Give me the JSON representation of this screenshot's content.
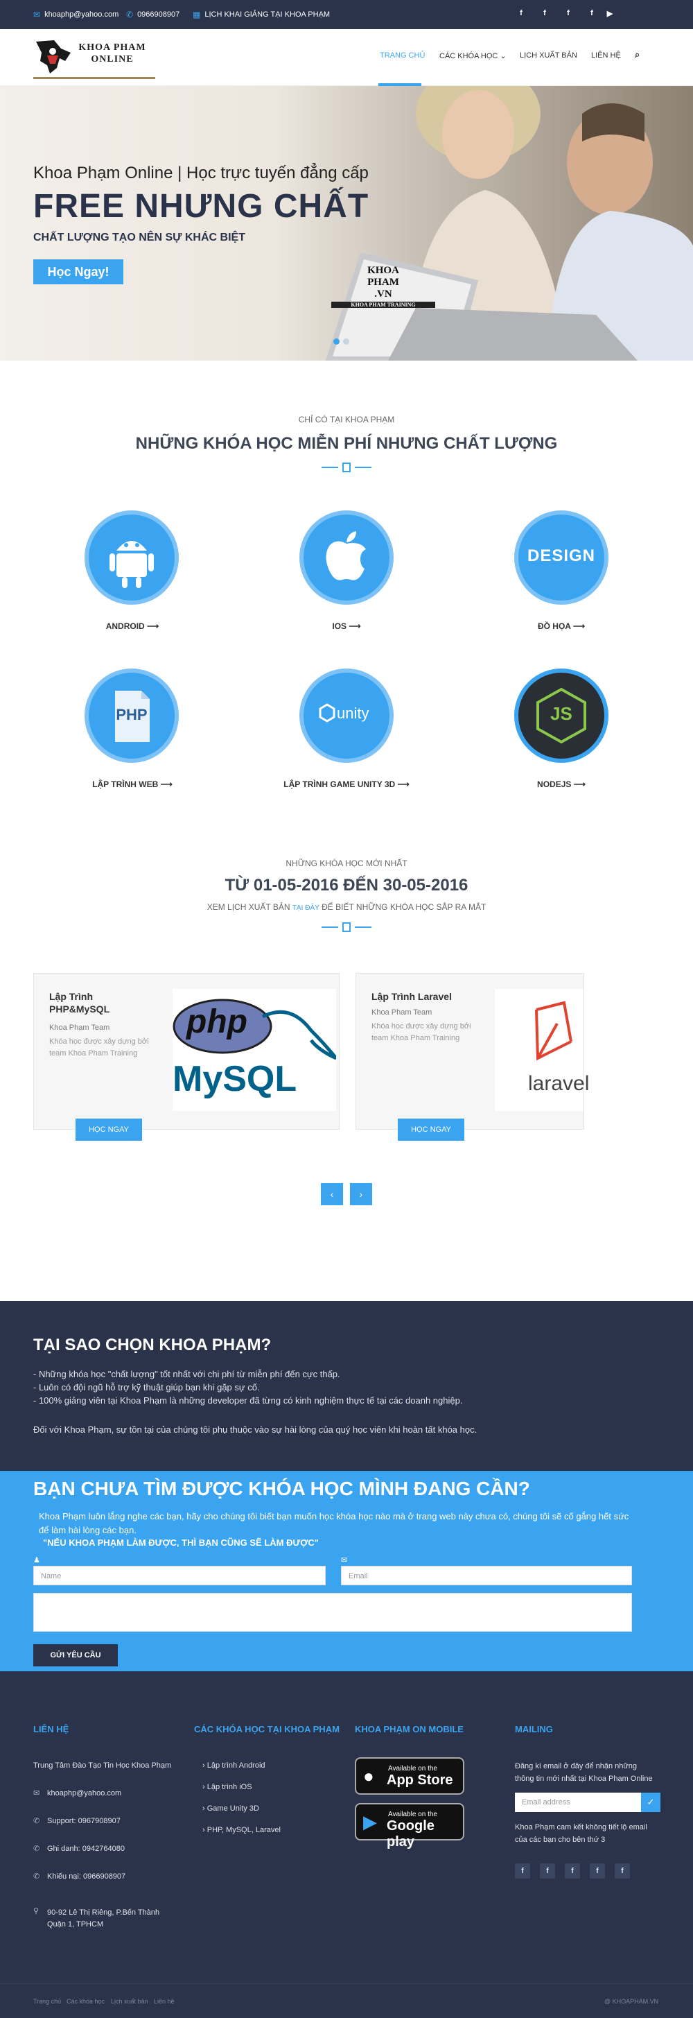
{
  "topbar": {
    "email": "khoaphp@yahoo.com",
    "phone": "0966908907",
    "schedule": "LỊCH KHAI GIẢNG TẠI KHOA PHẠM",
    "social": [
      "f",
      "f",
      "f",
      "f",
      "▶"
    ]
  },
  "header": {
    "logo_text_1": "KHOA PHAM",
    "logo_text_2": "ONLINE",
    "nav": [
      "TRANG CHỦ",
      "CÁC KHÓA HỌC ⌄",
      "LỊCH XUẤT BẢN",
      "LIÊN HỆ"
    ],
    "search_icon": "⌕"
  },
  "hero": {
    "subtitle": "Khoa Phạm Online | Học trực tuyến đẳng cấp",
    "title": "FREE NHƯNG CHẤT",
    "tagline": "CHẤT LƯỢNG TẠO NÊN SỰ KHÁC BIỆT",
    "button": "Học Ngay!",
    "laptop_logo_1": "KHOA",
    "laptop_logo_2": "PHAM",
    "laptop_logo_3": ".VN",
    "laptop_logo_4": "KHOA PHAM TRAINING"
  },
  "free_courses": {
    "small": "CHỈ CÓ TẠI KHOA PHẠM",
    "big": "NHỮNG KHÓA HỌC MIỄN PHÍ NHƯNG CHẤT LƯỢNG",
    "items": [
      "ANDROID ⟶",
      "IOS ⟶",
      "ĐỒ HỌA ⟶",
      "LẬP TRÌNH WEB ⟶",
      "LẬP TRÌNH GAME UNITY 3D ⟶",
      "NODEJS ⟶"
    ],
    "icon_text": [
      "DESIGN",
      "PHP",
      "unity",
      "JS"
    ]
  },
  "new_courses": {
    "small": "NHỮNG KHÓA HỌC MỚI NHẤT",
    "big": "TỪ 01-05-2016 ĐẾN 30-05-2016",
    "line_a": "XEM LỊCH XUẤT BẢN",
    "line_link": "TẠI ĐÂY",
    "line_b": "ĐỂ BIẾT NHỮNG KHÓA HỌC SẮP RA MẮT",
    "cards": [
      {
        "title_1": "Lập Trình",
        "title_2": "PHP&MySQL",
        "author": "Khoa Pham Team",
        "desc_1": "Khóa học được xây dựng bởi",
        "desc_2": "team Khoa Pham Training",
        "button": "HỌC NGAY",
        "img_1": "php",
        "img_2": "MySQL"
      },
      {
        "title_1": "Lập Trình Laravel",
        "author": "Khoa Pham Team",
        "desc_1": "Khóa học được xây dựng bởi",
        "desc_2": "team Khoa Pham Training",
        "button": "HỌC NGAY",
        "img_1": "laravel"
      }
    ],
    "prev": "‹",
    "next": "›"
  },
  "why": {
    "title": "TẠI SAO CHỌN KHOA PHẠM?",
    "lines": [
      "- Những khóa học \"chất lượng\" tốt nhất với chi phí từ miễn phí đến cực thấp.",
      "- Luôn có đội ngũ hỗ trợ kỹ thuật giúp bạn khi gặp sự cố.",
      "- 100% giảng viên tại Khoa Phạm là những developer đã từng có kinh nghiệm thực tế tại các doanh nghiệp.",
      "Đối với Khoa Phạm, sự tồn tại của chúng tôi phụ thuộc vào sự hài lòng của quý học viên khi hoàn tất khóa học."
    ]
  },
  "request": {
    "title": "BẠN CHƯA TÌM ĐƯỢC KHÓA HỌC MÌNH ĐANG CẦN?",
    "desc": "Khoa Phạm luôn lắng nghe các bạn, hãy cho chúng tôi biết bạn muốn học khóa học nào mà ở trang web này chưa có, chúng tôi sẽ cố gắng hết sức để làm hài lòng các bạn.",
    "quote": "\"NẾU KHOA PHẠM LÀM ĐƯỢC, THÌ BẠN CŨNG SẼ LÀM ĐƯỢC\"",
    "name_placeholder": "Name",
    "email_placeholder": "Email",
    "button": "GỬI YÊU CẦU"
  },
  "footer": {
    "contact_title": "LIÊN HỆ",
    "contact_org": "Trung Tâm Đào Tạo Tin Học Khoa Phạm",
    "contact_email": "khoaphp@yahoo.com",
    "contact_support": "Support: 0967908907",
    "contact_register": "Ghi danh: 0942764080",
    "contact_complaint": "Khiếu nại: 0966908907",
    "contact_addr_1": "90-92 Lê Thị Riêng, P.Bến Thành",
    "contact_addr_2": "Quận 1, TPHCM",
    "courses_title": "CÁC KHÓA HỌC TẠI KHOA PHẠM",
    "courses": [
      "Lập trình Android",
      "Lập trình iOS",
      "Game Unity 3D",
      "PHP, MySQL, Laravel"
    ],
    "mobile_title": "KHOA PHẠM ON MOBILE",
    "appstore_small": "Available on the",
    "appstore_big": "App Store",
    "gplay_small": "Available on the",
    "gplay_big": "Google play",
    "mailing_title": "MAILING",
    "mailing_desc_1": "Đăng kí email ở đây để nhận những",
    "mailing_desc_2": "thông tin mới nhất tại Khoa Phạm Online",
    "mailing_placeholder": "Email address",
    "mailing_note_1": "Khoa Phạm cam kết không tiết lộ email",
    "mailing_note_2": "của các bạn cho bên thứ 3",
    "social": [
      "f",
      "f",
      "f",
      "f",
      "f"
    ],
    "bottom_links": [
      "Trang chủ",
      "Các khóa học",
      "Lịch xuất bản",
      "Liên hệ"
    ],
    "copyright": "@ KHOAPHAM.VN"
  }
}
